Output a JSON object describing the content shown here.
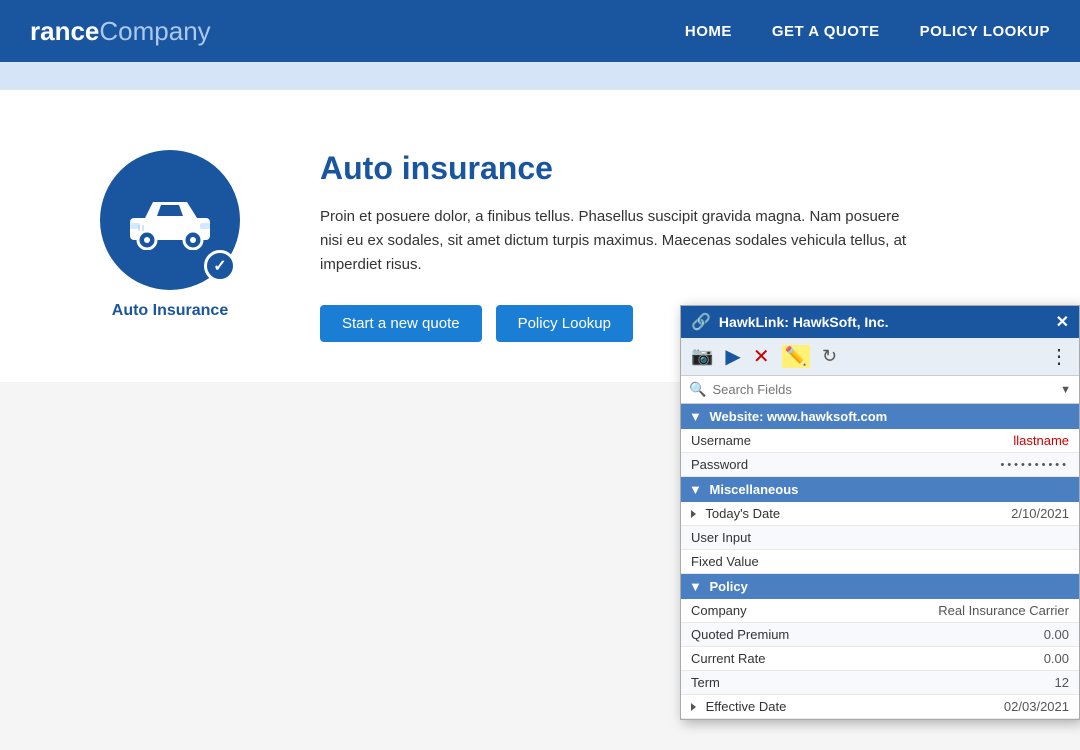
{
  "brand": {
    "bold": "rance",
    "light": "Company"
  },
  "nav": {
    "links": [
      "HOME",
      "GET A QUOTE",
      "POLICY LOOKUP"
    ]
  },
  "hero": {
    "title": "Auto insurance",
    "description": "Proin et posuere dolor, a finibus tellus. Phasellus suscipit gravida magna. Nam posuere nisi eu ex sodales, sit amet dictum turpis maximus. Maecenas sodales vehicula tellus, at imperdiet risus.",
    "btn1": "Start a new quote",
    "btn2": "Policy Lookup",
    "icon_label": "Auto Insurance"
  },
  "hawklink": {
    "title": "HawkLink: HawkSoft, Inc.",
    "search_placeholder": "Search Fields",
    "sections": {
      "website": {
        "header": "Website: www.hawksoft.com",
        "rows": [
          {
            "label": "Username",
            "value": "llastname"
          },
          {
            "label": "Password",
            "value": "••••••••••"
          }
        ]
      },
      "misc": {
        "header": "Miscellaneous",
        "rows": [
          {
            "label": "Today's Date",
            "value": "2/10/2021",
            "has_arrow": true
          },
          {
            "label": "User Input",
            "value": ""
          },
          {
            "label": "Fixed Value",
            "value": ""
          }
        ]
      },
      "policy": {
        "header": "Policy",
        "rows": [
          {
            "label": "Company",
            "value": "Real Insurance Carrier"
          },
          {
            "label": "Quoted Premium",
            "value": "0.00"
          },
          {
            "label": "Current Rate",
            "value": "0.00"
          },
          {
            "label": "Term",
            "value": "12"
          },
          {
            "label": "Effective Date",
            "value": "02/03/2021",
            "has_arrow": true
          }
        ]
      }
    }
  }
}
